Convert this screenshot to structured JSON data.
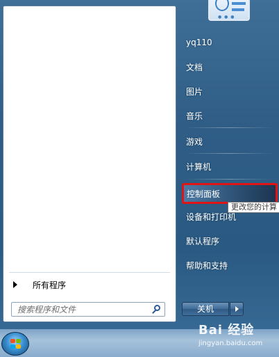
{
  "left_pane": {
    "all_programs_label": "所有程序",
    "search_placeholder": "搜索程序和文件"
  },
  "right_menu": {
    "items": [
      {
        "label": "yq110"
      },
      {
        "label": "文档"
      },
      {
        "label": "图片"
      },
      {
        "label": "音乐"
      },
      {
        "label": "游戏"
      },
      {
        "label": "计算机"
      },
      {
        "label": "控制面板"
      },
      {
        "label": "设备和打印机"
      },
      {
        "label": "默认程序"
      },
      {
        "label": "帮助和支持"
      }
    ],
    "tooltip": "更改您的计算"
  },
  "shutdown": {
    "label": "关机"
  },
  "watermark": {
    "brand": "Bai 经验",
    "url": "jingyan.baidu.com"
  },
  "colors": {
    "highlight_border": "#e01414",
    "menu_background": "#2f5d86"
  }
}
